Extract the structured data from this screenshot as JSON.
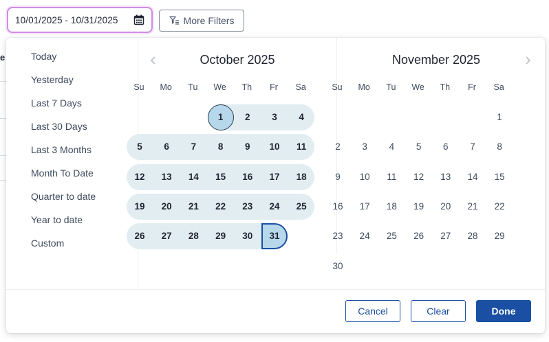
{
  "date_range": {
    "value": "10/01/2025 - 10/31/2025"
  },
  "toolbar": {
    "more_filters_label": "More Filters"
  },
  "presets": [
    "Today",
    "Yesterday",
    "Last 7 Days",
    "Last 30 Days",
    "Last 3 Months",
    "Month To Date",
    "Quarter to date",
    "Year to date",
    "Custom"
  ],
  "weekdays": [
    "Su",
    "Mo",
    "Tu",
    "We",
    "Th",
    "Fr",
    "Sa"
  ],
  "calendars": [
    {
      "title": "October 2025",
      "first_weekday": 3,
      "days": 31,
      "range_start": 1,
      "range_end": 31
    },
    {
      "title": "November 2025",
      "first_weekday": 6,
      "days": 30
    }
  ],
  "footer": {
    "cancel_label": "Cancel",
    "clear_label": "Clear",
    "done_label": "Done"
  },
  "colors": {
    "accent": "#1a4fa3",
    "range_fill": "#e2edf2",
    "selected_fill": "#b7d8ea",
    "focus_ring": "#d08be6"
  },
  "icons": {
    "date_input": "calendar-icon",
    "filters": "filter-icon",
    "prev": "chevron-left-icon",
    "next": "chevron-right-icon"
  }
}
